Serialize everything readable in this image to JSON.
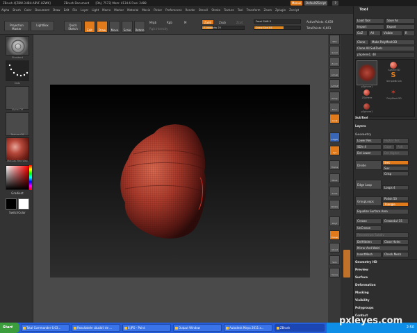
{
  "titlebar": {
    "title": "ZBrush 4[ZBW-3HBH-ABVF-HZWK]",
    "document": "ZBrush Document",
    "stats": "[Obj: 7573]  Mem: 4134-6  Free: 2488",
    "menus_btn": "Menus",
    "script_btn": "DefaultZScript"
  },
  "menubar": [
    "Alpha",
    "Brush",
    "Color",
    "Document",
    "Draw",
    "Edit",
    "File",
    "Layer",
    "Light",
    "Macro",
    "Marker",
    "Material",
    "Movie",
    "Picker",
    "Preferences",
    "Render",
    "Stencil",
    "Stroke",
    "Texture",
    "Tool",
    "Transform",
    "Zoom",
    "Zplugin",
    "Zscript"
  ],
  "shelf": {
    "projection_master": "Projection Master",
    "lightbox": "LightBox",
    "quick_sketch": "Quick Sketch",
    "edit": "Edit",
    "draw": "Draw",
    "move": "Move",
    "scale": "Scale",
    "rotate": "Rotate",
    "mrgb": "Mrgb",
    "rgb": "Rgb",
    "m": "M",
    "zadd": "Zadd",
    "zsub": "Zsub",
    "zcut": "Zcut",
    "rgb_intensity": "Rgb Intensity",
    "z_intensity": "Z Intensity 25",
    "focal_shift": "Focal Shift 0",
    "draw_size": "Draw Size 64",
    "active_points": "ActivePoints: 6,659",
    "total_points": "TotalPoints: 6,661",
    "z_intensity_level": 0.25,
    "focal_shift_level": 0.0,
    "draw_size_level": 0.64
  },
  "lefttray": {
    "thumb_labels": [
      "Standard",
      "Dots",
      "Alpha Off",
      "Texture Off",
      "MatCap Red Wax"
    ],
    "gradient": "Gradient",
    "switchcolor": "SwitchColor"
  },
  "rstrip": [
    "SPix",
    "Scroll",
    "Zoom",
    "Actual",
    "AAHalf",
    "Persp",
    "Floor",
    "Local",
    "L.Sym",
    "Xyz",
    "Frame",
    "Move",
    "Scale",
    "Rotate",
    "PolyF",
    "Transp",
    "Ghost",
    "Solo",
    "Xpose"
  ],
  "palette": {
    "title": "Tool",
    "load_tool": "Load Tool",
    "save_as": "Save As",
    "import": "Import",
    "export": "Export",
    "goz": "GoZ",
    "all": "All",
    "visible": "Visible",
    "r": "R",
    "clone": "Clone",
    "make_polymesh": "Make PolyMesh3D",
    "clone_all": "Clone All SubTools",
    "current_tool": "pSphere1. 48",
    "tools": [
      "pSphere1",
      "Sphere3D",
      "SimpleBrush",
      "ZSphere",
      "PolyMesh3D",
      "pSphere1"
    ],
    "subtool": "SubTool",
    "layers": "Layers",
    "geometry": "Geometry",
    "lower_res": "Lower Res",
    "higher_res": "Higher Res",
    "sdiv": "SDiv 4",
    "cage": "Cage",
    "rstr": "Rstr",
    "del_lower": "Del Lower",
    "del_higher": "Del Higher",
    "divide": "Divide",
    "smt": "Smt",
    "suv": "Suv",
    "crisp": "Crisp",
    "edge_loop": "Edge Loop",
    "loops": "Loops 4",
    "polish": "Polish 50",
    "grouploops": "GroupLoops",
    "triangle": "Triangle",
    "equalize": "Equalize Surface Area",
    "crease": "Crease",
    "creaselvl": "CreaseLvl 15",
    "uncrease": "UnCrease",
    "reconstruct": "Reconstruct Subdiv",
    "delhidden": "DelHidden",
    "close_holes": "Close Holes",
    "mirror_weld": "Mirror And Weld",
    "insert_mesh": "InsertMesh",
    "check_mesh": "Check Mesh",
    "sections": [
      "Geometry HD",
      "Preview",
      "Surface",
      "Deformation",
      "Masking",
      "Visibility",
      "Polygroups",
      "Contact"
    ]
  },
  "taskbar": {
    "start": "Start",
    "tasks": [
      "Total Commander 6.03...",
      "Rezultatele căutării de ...",
      "8.JPG - Paint",
      "Output Window",
      "Autodesk Maya 2011 x...",
      "ZBrush"
    ],
    "clock": "2:50"
  },
  "watermark": "pxleyes.com"
}
